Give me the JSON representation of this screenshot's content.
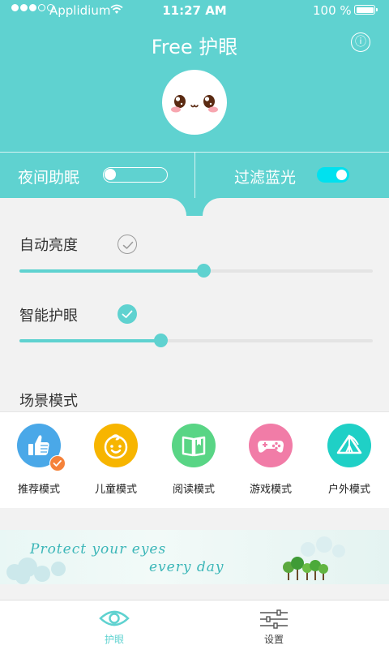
{
  "status_bar": {
    "carrier": "Applidium",
    "time": "11:27 AM",
    "battery": "100 %"
  },
  "header": {
    "title": "Free 护眼",
    "info_icon": "ⓘ"
  },
  "toggles": {
    "night_sleep": {
      "label": "夜间助眠",
      "on": false
    },
    "blue_filter": {
      "label": "过滤蓝光",
      "on": true
    }
  },
  "brightness": {
    "auto": {
      "label": "自动亮度",
      "checked": false,
      "level": 0.52
    },
    "smart": {
      "label": "智能护眼",
      "checked": true,
      "level": 0.4
    }
  },
  "scenes": {
    "title": "场景模式",
    "items": [
      {
        "label": "推荐模式",
        "icon": "thumbs-up-icon",
        "color": "#4aa8e8",
        "selected": true
      },
      {
        "label": "儿童模式",
        "icon": "child-face-icon",
        "color": "#f7b500",
        "selected": false
      },
      {
        "label": "阅读模式",
        "icon": "book-icon",
        "color": "#59d585",
        "selected": false
      },
      {
        "label": "游戏模式",
        "icon": "gamepad-icon",
        "color": "#f17ca7",
        "selected": false
      },
      {
        "label": "户外模式",
        "icon": "tent-icon",
        "color": "#1fd0c6",
        "selected": false
      }
    ]
  },
  "banner": {
    "line1": "Protect your eyes",
    "line2": "every day"
  },
  "tabbar": {
    "tabs": [
      {
        "label": "护眼",
        "icon": "eye-icon",
        "active": true
      },
      {
        "label": "设置",
        "icon": "sliders-icon",
        "active": false
      }
    ]
  },
  "colors": {
    "accent": "#5fd2d0",
    "toggle_on": "#00e1ef",
    "badge": "#f5823a"
  }
}
